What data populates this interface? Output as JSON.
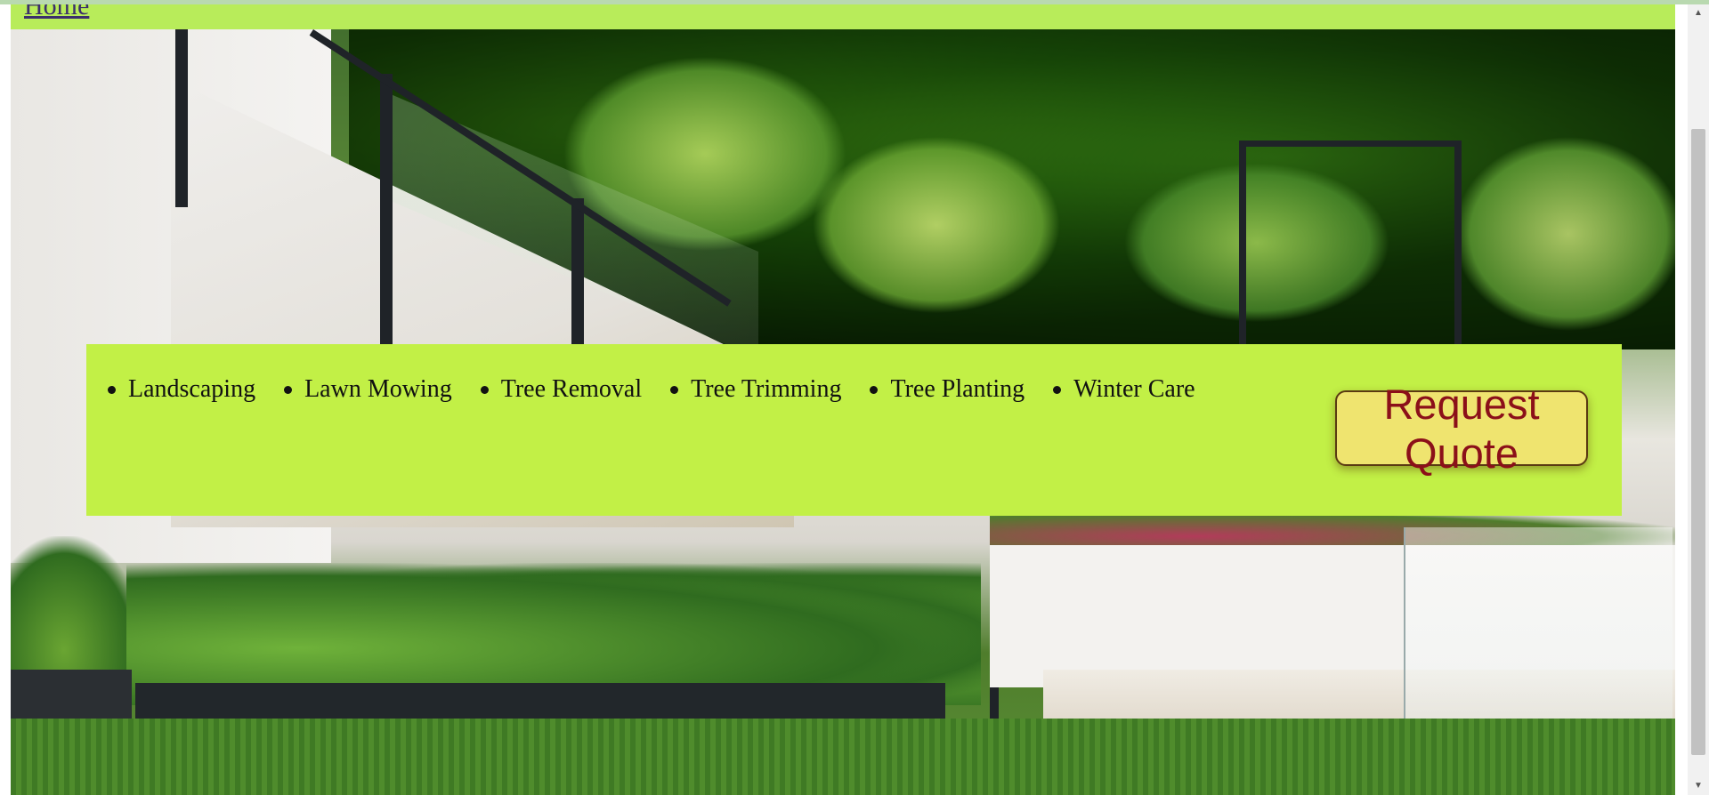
{
  "nav": {
    "home_label": "Home"
  },
  "services": {
    "items": [
      {
        "label": "Landscaping"
      },
      {
        "label": "Lawn Mowing"
      },
      {
        "label": "Tree Removal"
      },
      {
        "label": "Tree Trimming"
      },
      {
        "label": "Tree Planting"
      },
      {
        "label": "Winter Care"
      }
    ]
  },
  "cta": {
    "request_quote_label": "Request Quote"
  },
  "icons": {
    "scroll_up": "chevron-up-icon",
    "scroll_down": "chevron-down-icon"
  },
  "colors": {
    "header_bar": "#b8ec5a",
    "service_panel": "#c2f046",
    "quote_button_bg": "#efe46f",
    "quote_button_text": "#8b1019"
  }
}
